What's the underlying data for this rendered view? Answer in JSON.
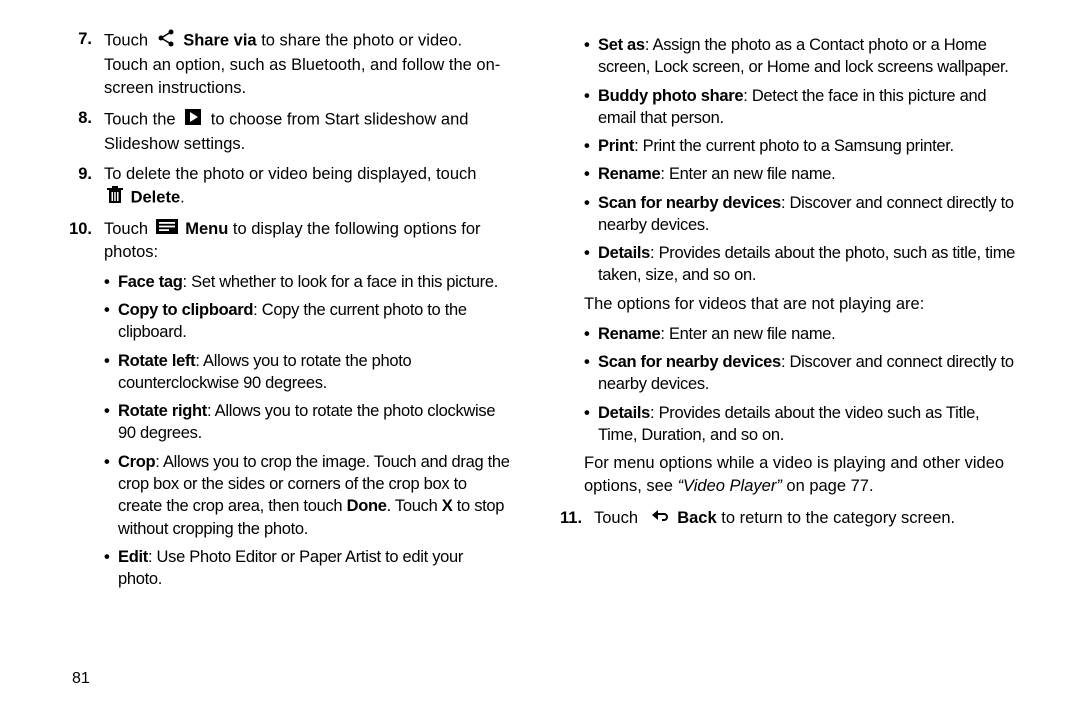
{
  "pagenum": "81",
  "steps": {
    "s7": {
      "num": "7.",
      "pre": "Touch ",
      "bold": "Share via",
      "post": " to share the photo or video. Touch an option, such as Bluetooth, and follow the on-screen instructions."
    },
    "s8": {
      "num": "8.",
      "pre": "Touch the ",
      "post": " to choose from Start slideshow and Slideshow settings."
    },
    "s9": {
      "num": "9.",
      "text": "To delete the photo or video being displayed, touch ",
      "bold": "Delete",
      "dot": "."
    },
    "s10": {
      "num": "10.",
      "pre": "Touch ",
      "bold": "Menu",
      "post": " to display the following options for photos:"
    },
    "s11": {
      "num": "11.",
      "pre": "Touch ",
      "bold": "Back",
      "post": " to return to the category screen."
    }
  },
  "photoOptions": [
    {
      "b": "Face tag",
      "t": ": Set whether to look for a face in this picture."
    },
    {
      "b": "Copy to clipboard",
      "t": ": Copy the current photo to the clipboard."
    },
    {
      "b": "Rotate left",
      "t": ": Allows you to rotate the photo counterclockwise 90 degrees."
    },
    {
      "b": "Rotate right",
      "t": ": Allows you to rotate the photo clockwise 90 degrees."
    },
    {
      "b": "Crop",
      "t0": ": Allows you to crop the image. Touch and drag the crop box or the sides or corners of the crop box to create the crop area, then touch ",
      "b1": "Done",
      "t1": ". Touch ",
      "b2": "X",
      "t2": " to stop without cropping the photo."
    },
    {
      "b": "Edit",
      "t": ": Use Photo Editor or Paper Artist to edit your photo."
    }
  ],
  "photoOptionsRight": [
    {
      "b": "Set as",
      "t": ": Assign the photo as a Contact photo or a Home screen, Lock screen, or Home and lock screens wallpaper."
    },
    {
      "b": "Buddy photo share",
      "t": ": Detect the face in this picture and email that person."
    },
    {
      "b": "Print",
      "t": ": Print the current photo to a Samsung printer."
    },
    {
      "b": "Rename",
      "t": ": Enter an new file name."
    },
    {
      "b": "Scan for nearby devices",
      "t": ": Discover and connect directly to nearby devices."
    },
    {
      "b": "Details",
      "t": ": Provides details about the photo, such as title, time taken, size, and so on."
    }
  ],
  "videoNote": "The options for videos that are not playing are:",
  "videoOptions": [
    {
      "b": "Rename",
      "t": ": Enter an new file name."
    },
    {
      "b": "Scan for nearby devices",
      "t": ": Discover and connect directly to nearby devices."
    },
    {
      "b": "Details",
      "t": ": Provides details about the video such as Title, Time, Duration, and so on."
    }
  ],
  "videoFooter": {
    "pre": "For menu options while a video is playing and other video options, see ",
    "italic": "“Video Player”",
    "post": " on page 77."
  }
}
